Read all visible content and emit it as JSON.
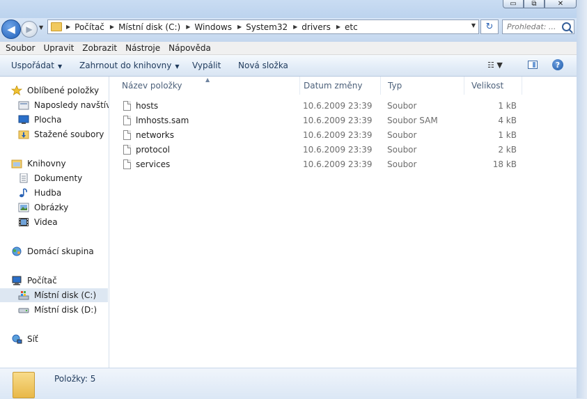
{
  "window": {
    "minimize_glyph": "▭",
    "maximize_glyph": "⧉",
    "close_glyph": "✕"
  },
  "nav": {
    "back_glyph": "◀",
    "forward_glyph": "▶",
    "history_glyph": "▼",
    "breadcrumb": [
      "Počítač",
      "Místní disk (C:)",
      "Windows",
      "System32",
      "drivers",
      "etc"
    ],
    "address_dropdown_glyph": "▼",
    "refresh_glyph": "↻",
    "search_placeholder": "Prohledat: ..."
  },
  "menubar": [
    "Soubor",
    "Upravit",
    "Zobrazit",
    "Nástroje",
    "Nápověda"
  ],
  "commandbar": {
    "organize": "Uspořádat",
    "include_library": "Zahrnout do knihovny",
    "burn": "Vypálit",
    "new_folder": "Nová složka",
    "views_glyph": "☷ ▼",
    "help_glyph": "?"
  },
  "sidebar": {
    "favorites": {
      "label": "Oblíbené položky",
      "items": [
        "Naposledy navštívené",
        "Plocha",
        "Stažené soubory"
      ]
    },
    "libraries": {
      "label": "Knihovny",
      "items": [
        "Dokumenty",
        "Hudba",
        "Obrázky",
        "Videa"
      ]
    },
    "homegroup": {
      "label": "Domácí skupina"
    },
    "computer": {
      "label": "Počítač",
      "items": [
        "Místní disk (C:)",
        "Místní disk (D:)"
      ],
      "selected": "Místní disk (C:)"
    },
    "network": {
      "label": "Síť"
    }
  },
  "columns": {
    "name": "Název položky",
    "date": "Datum změny",
    "type": "Typ",
    "size": "Velikost",
    "sort_glyph": "▲"
  },
  "files": [
    {
      "name": "hosts",
      "date": "10.6.2009 23:39",
      "type": "Soubor",
      "size": "1 kB"
    },
    {
      "name": "lmhosts.sam",
      "date": "10.6.2009 23:39",
      "type": "Soubor SAM",
      "size": "4 kB"
    },
    {
      "name": "networks",
      "date": "10.6.2009 23:39",
      "type": "Soubor",
      "size": "1 kB"
    },
    {
      "name": "protocol",
      "date": "10.6.2009 23:39",
      "type": "Soubor",
      "size": "2 kB"
    },
    {
      "name": "services",
      "date": "10.6.2009 23:39",
      "type": "Soubor",
      "size": "18 kB"
    }
  ],
  "details": {
    "count": "Položky: 5"
  }
}
